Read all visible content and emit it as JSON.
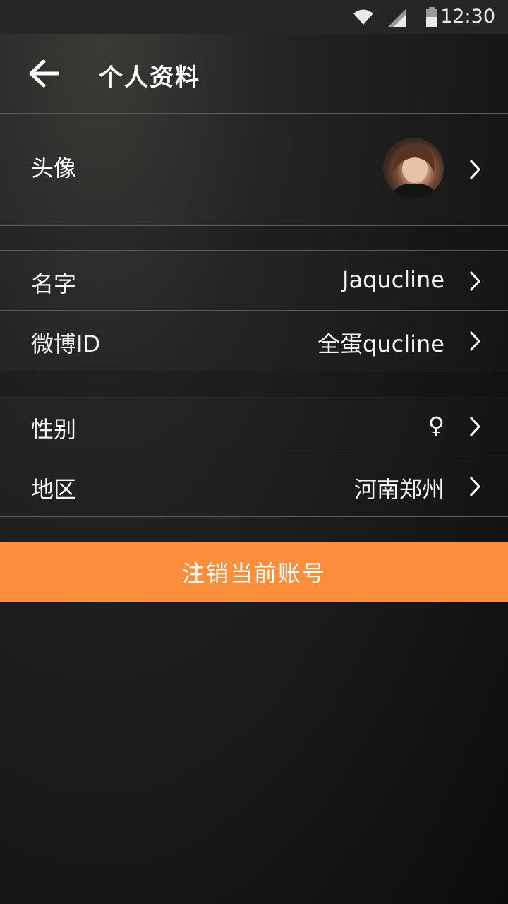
{
  "status_bar": {
    "time": "12:30"
  },
  "header": {
    "title": "个人资料"
  },
  "profile": {
    "avatar_label": "头像",
    "name_label": "名字",
    "name_value": "Jaqucline",
    "weibo_label": "微博ID",
    "weibo_value": "全蛋qucline",
    "gender_label": "性别",
    "gender_value": "♀",
    "region_label": "地区",
    "region_value": "河南郑州"
  },
  "actions": {
    "logout_label": "注销当前账号"
  },
  "colors": {
    "accent": "#fd8e3c",
    "divider": "#5a5a5a"
  }
}
